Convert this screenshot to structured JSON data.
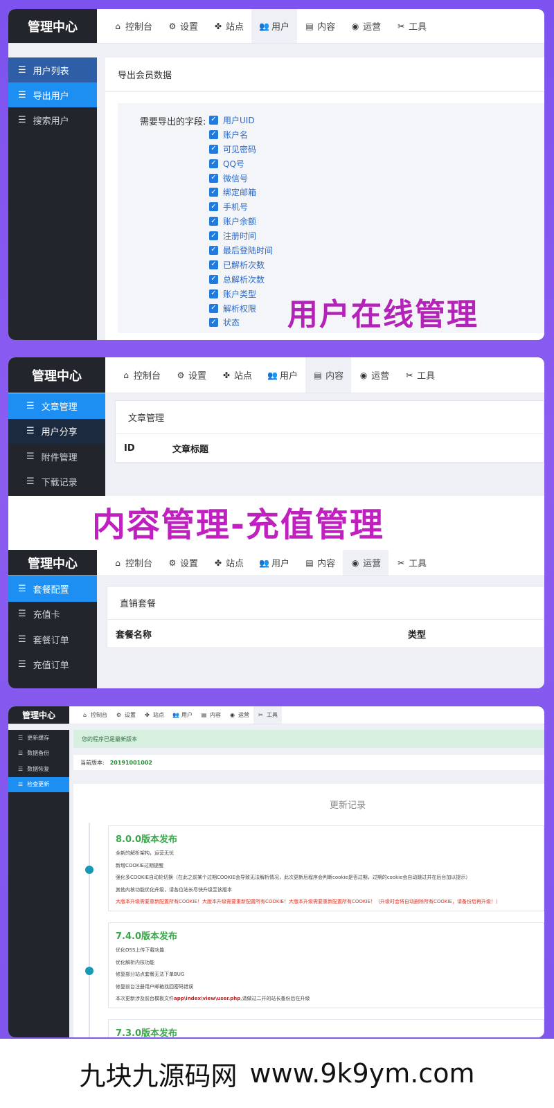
{
  "tabs": [
    {
      "icon": "home-icon",
      "glyph": "⌂",
      "label": "控制台"
    },
    {
      "icon": "gear-icon",
      "glyph": "⚙",
      "label": "设置"
    },
    {
      "icon": "sitemap-icon",
      "glyph": "✤",
      "label": "站点"
    },
    {
      "icon": "users-icon",
      "glyph": "👥",
      "label": "用户"
    },
    {
      "icon": "document-icon",
      "glyph": "▤",
      "label": "内容"
    },
    {
      "icon": "globe-icon",
      "glyph": "◉",
      "label": "运营"
    },
    {
      "icon": "tools-icon",
      "glyph": "✂",
      "label": "工具"
    }
  ],
  "brand": "管理中心",
  "panel1": {
    "sidebar": [
      "用户列表",
      "导出用户",
      "搜索用户"
    ],
    "section_title": "导出会员数据",
    "field_label": "需要导出的字段:",
    "fields": [
      "用户UID",
      "账户名",
      "可见密码",
      "QQ号",
      "微信号",
      "绑定邮箱",
      "手机号",
      "账户余额",
      "注册时间",
      "最后登陆时间",
      "已解析次数",
      "总解析次数",
      "账户类型",
      "解析权限",
      "状态"
    ],
    "overlay": "用户在线管理"
  },
  "panel2": {
    "sidebar": [
      "文章管理",
      "用户分享",
      "附件管理",
      "下载记录"
    ],
    "section_title": "文章管理",
    "columns": [
      "ID",
      "文章标题"
    ]
  },
  "overlay2": "内容管理-充值管理",
  "panel3": {
    "sidebar": [
      "套餐配置",
      "充值卡",
      "套餐订单",
      "充值订单"
    ],
    "section_title": "直销套餐",
    "columns": [
      "套餐名称",
      "类型"
    ]
  },
  "panel4": {
    "sidebar": [
      "更新缓存",
      "数据备份",
      "数据恢复",
      "检查更新"
    ],
    "alert": "您的程序已是最新版本",
    "version_label": "当前版本:",
    "version_value": "20191001002",
    "changelog_title": "更新记录",
    "entries": [
      {
        "title": "8.0.0版本发布",
        "lines": [
          "全新的解析架构，运营无忧",
          "新增COOKIE过期提醒",
          "强化多COOKIE自动轮切换（在此之前某个过期COOKIE会导致无法解析情况，此次更新后程序会判断cookie是否过期，过期的cookie会自动跳过并在后台加以提示）",
          "其他内核功能优化升级，请各位站长尽快升级至该版本"
        ],
        "warning": "大版本升级需要重新配置所有COOKIE！大版本升级需要重新配置所有COOKIE！大版本升级需要重新配置所有COOKIE！（升级时会将自动删除所有COOKIE，请备份后再升级！）"
      },
      {
        "title": "7.4.0版本发布",
        "lines": [
          "优化OSS上传下载功能",
          "优化解析内核功能",
          "修复部分站点套餐无法下单BUG",
          "修复前台注册用户邮箱找回密码错误"
        ],
        "note_pre": "本次更新涉及前台模板文件",
        "note_path": "app\\index\\view\\user.php",
        "note_post": ",请做过二开的站长备份后在升级"
      },
      {
        "title": "7.3.0版本发布",
        "lines": []
      }
    ]
  },
  "footer": {
    "name": "九块九源码网",
    "site": "www.9k9ym.com"
  },
  "colors": {
    "accent": "#1e8ff2",
    "sidebar_bg": "#23252c",
    "overlay_text": "#b423b8",
    "version_green": "#3aa64a"
  }
}
